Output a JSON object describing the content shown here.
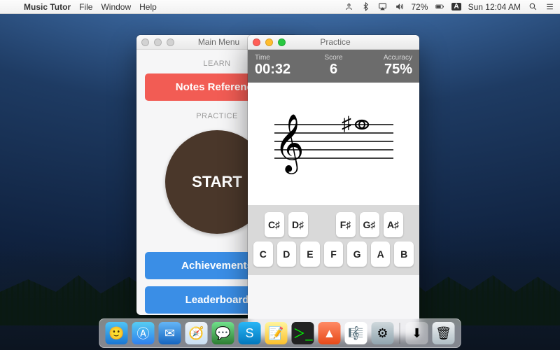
{
  "menubar": {
    "app_name": "Music Tutor",
    "items": [
      "File",
      "Window",
      "Help"
    ],
    "battery": "72%",
    "input_indicator": "A",
    "clock": "Sun 12:04 AM"
  },
  "main_menu_window": {
    "title": "Main Menu",
    "learn_label": "LEARN",
    "notes_reference_label": "Notes Reference",
    "practice_label": "PRACTICE",
    "start_label": "START",
    "achievements_label": "Achievements",
    "leaderboard_label": "Leaderboard"
  },
  "practice_window": {
    "title": "Practice",
    "stats": {
      "time_label": "Time",
      "time_value": "00:32",
      "score_label": "Score",
      "score_value": "6",
      "accuracy_label": "Accuracy",
      "accuracy_value": "75%"
    },
    "displayed_note": {
      "clef": "treble",
      "accidental": "sharp",
      "line": "top-line"
    },
    "keys_sharps": [
      "C♯",
      "D♯",
      "F♯",
      "G♯",
      "A♯"
    ],
    "keys_naturals": [
      "C",
      "D",
      "E",
      "F",
      "G",
      "A",
      "B"
    ]
  },
  "dock": {
    "apps": [
      "finder",
      "app-store",
      "mail",
      "safari",
      "messages",
      "skype",
      "notes",
      "terminal",
      "vlc",
      "music-tutor",
      "system-preferences"
    ],
    "right": [
      "downloads",
      "trash"
    ]
  },
  "colors": {
    "red_button": "#f25c54",
    "blue_button": "#3a8ee6",
    "start_circle": "#4a372a",
    "stats_bar": "#6c6c6c"
  }
}
